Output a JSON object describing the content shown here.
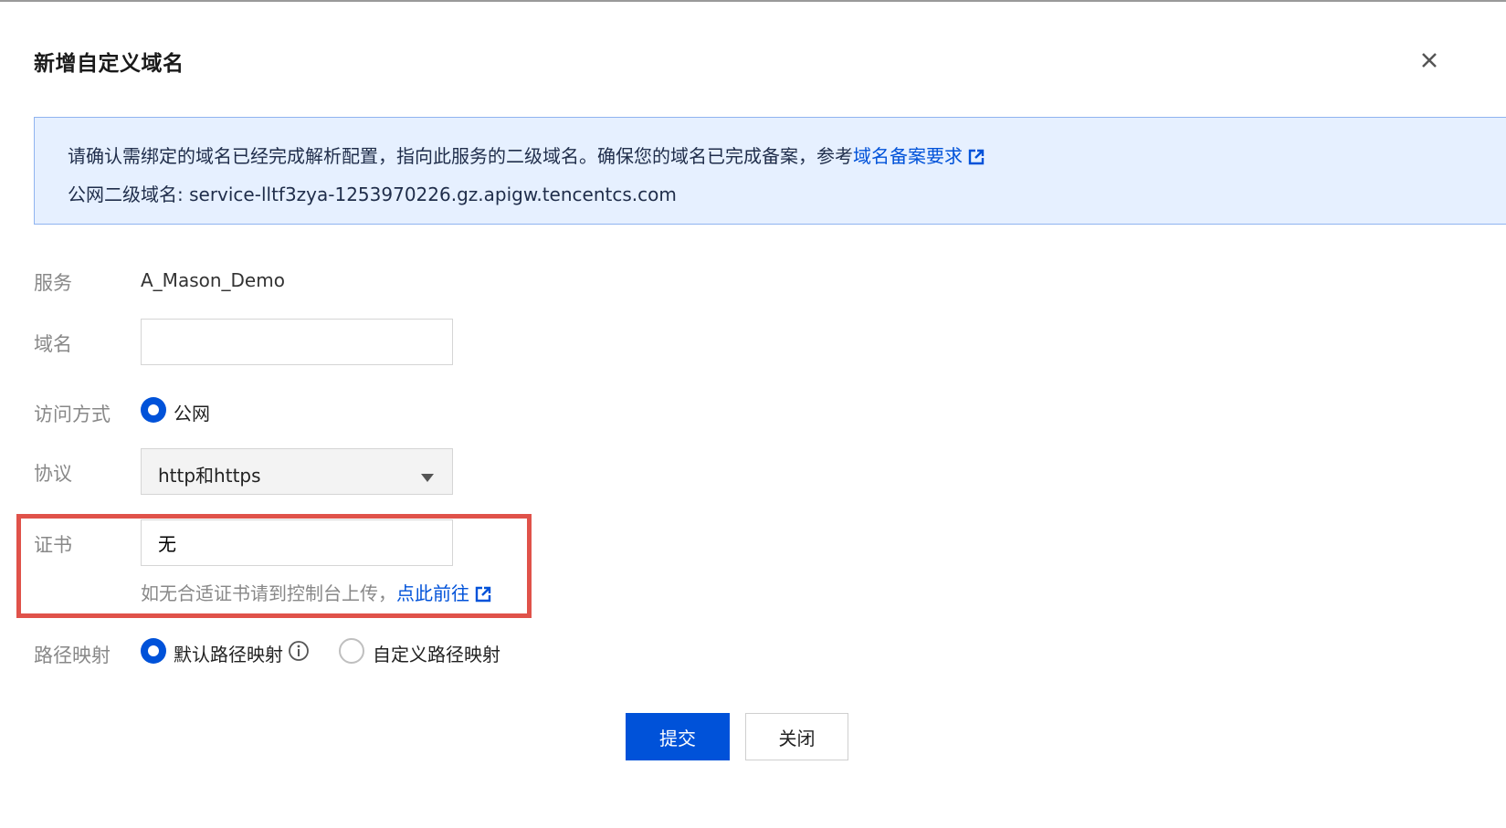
{
  "dialog": {
    "title": "新增自定义域名",
    "close_icon": "close-icon"
  },
  "notice": {
    "line1_text": "请确认需绑定的域名已经完成解析配置，指向此服务的二级域名。确保您的域名已完成备案，参考",
    "line1_link": "域名备案要求",
    "line2_text": "公网二级域名: service-lltf3zya-1253970226.gz.apigw.tencentcs.com",
    "link_icon": "external-link-icon"
  },
  "form": {
    "service": {
      "label": "服务",
      "value": "A_Mason_Demo"
    },
    "domain": {
      "label": "域名",
      "value": "",
      "placeholder": ""
    },
    "access": {
      "label": "访问方式",
      "option": "公网",
      "selected": true
    },
    "protocol": {
      "label": "协议",
      "value": "http和https",
      "caret_icon": "caret-down-icon"
    },
    "cert": {
      "label": "证书",
      "value": "无",
      "hint_text": "如无合适证书请到控制台上传，",
      "hint_link": "点此前往"
    },
    "path_mapping": {
      "label": "路径映射",
      "option_default": "默认路径映射",
      "option_custom": "自定义路径映射",
      "selected": "默认路径映射",
      "info_icon": "info-icon"
    }
  },
  "buttons": {
    "submit": "提交",
    "close": "关闭"
  },
  "colors": {
    "primary": "#0052d9",
    "notice_bg": "#e6f0ff",
    "highlight": "#e0524a"
  }
}
